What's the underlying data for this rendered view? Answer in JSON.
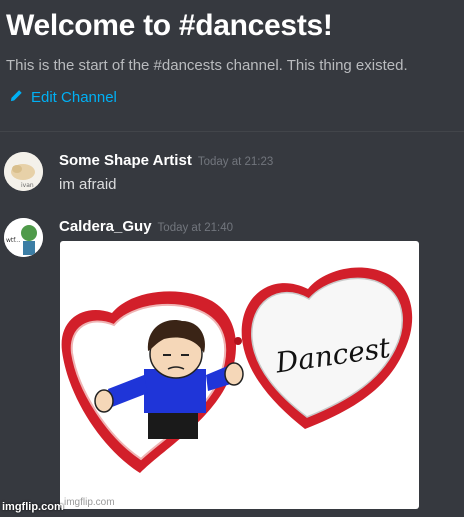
{
  "channel": {
    "welcome_title": "Welcome to #dancests!",
    "welcome_subtitle": "This is the start of the #dancests channel. This thing existed.",
    "edit_channel_label": "Edit Channel"
  },
  "messages": [
    {
      "author": "Some Shape Artist",
      "timestamp": "Today at 21:23",
      "text": "im afraid",
      "avatar_label": "ivan"
    },
    {
      "author": "Caldera_Guy",
      "timestamp": "Today at 21:40",
      "avatar_label": "wtf...",
      "attachment": {
        "heart_text": "Dancest",
        "watermark": "imgflip.com"
      }
    }
  ],
  "footer_watermark": "imgflip.com",
  "colors": {
    "background": "#36393f",
    "link": "#00b0f4",
    "heart_frame": "#d21f2a"
  },
  "icons": [
    "pencil-icon"
  ]
}
